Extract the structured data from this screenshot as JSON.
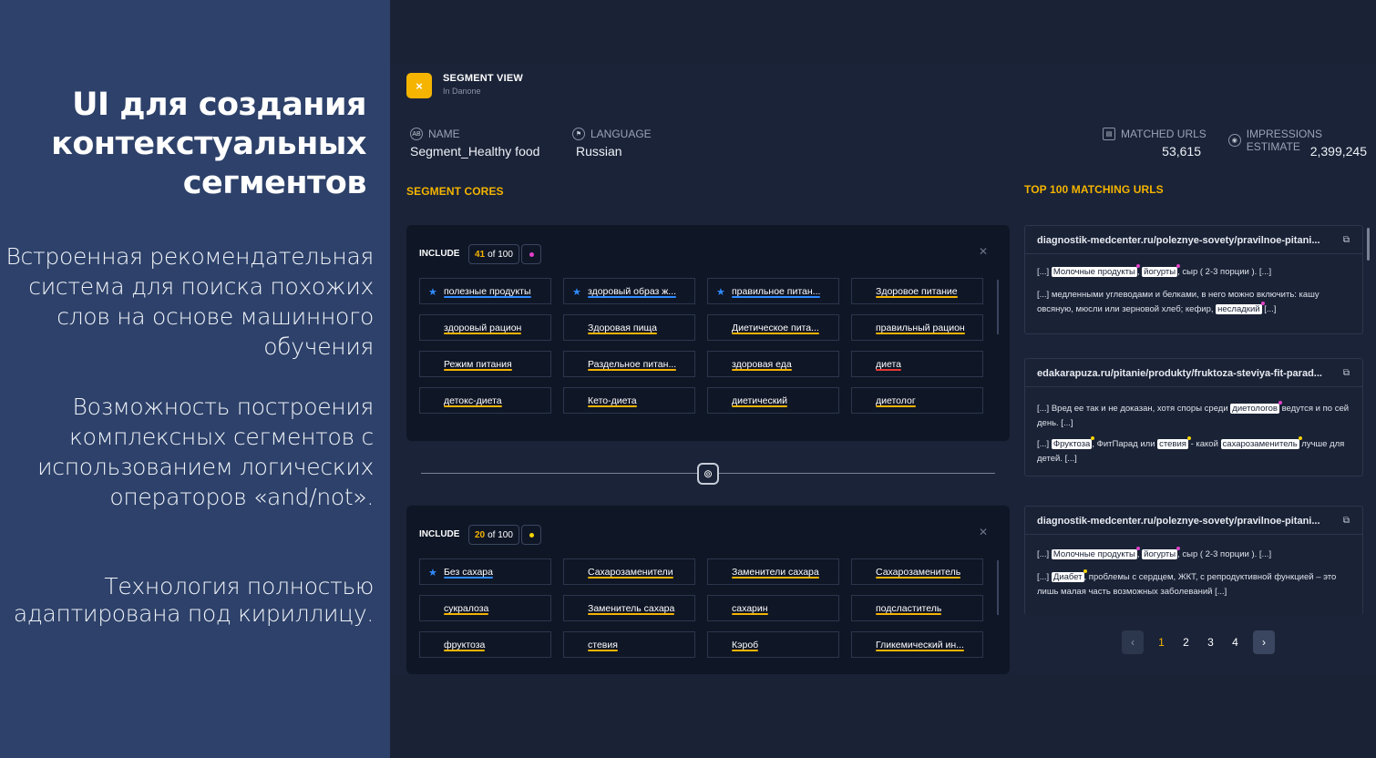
{
  "slide": {
    "title": "UI для создания контекстуальных сегментов",
    "p1": "Встроенная рекомендательная система для поиска похожих слов на основе машинного обучения",
    "p2": "Возможность построения комплексных сегментов с использованием логических операторов «and/not».",
    "p3": "Технология полностью адаптирована под кириллицу."
  },
  "header": {
    "logo": "×",
    "title": "SEGMENT VIEW",
    "subtitle": "In Danone"
  },
  "meta": {
    "name_label": "NAME",
    "name_icon": "AB",
    "name_value": "Segment_Healthy food",
    "language_label": "LANGUAGE",
    "language_icon": "flag-icon",
    "language_value": "Russian",
    "matched_label": "MATCHED URLS",
    "matched_icon": "document-icon",
    "matched_value": "53,615",
    "impressions_label": "IMPRESSIONS ESTIMATE",
    "impressions_icon": "eye-icon",
    "impressions_value": "2,399,245"
  },
  "segment_cores_title": "SEGMENT CORES",
  "top_urls_title": "TOP 100 MATCHING URLS",
  "cores": [
    {
      "include_label": "INCLUDE",
      "count_current": "41",
      "count_total": "of 100",
      "dot_color": "#e040c8",
      "chips": [
        {
          "label": "полезные продукты",
          "star": true,
          "color": "#2e8bff"
        },
        {
          "label": "здоровый образ ж...",
          "star": true,
          "color": "#2e8bff"
        },
        {
          "label": "правильное питан...",
          "star": true,
          "color": "#2e8bff"
        },
        {
          "label": "Здоровое питание",
          "star": false,
          "color": "#f5b400"
        },
        {
          "label": "здоровый рацион",
          "star": false,
          "color": "#f5b400"
        },
        {
          "label": "Здоровая пища",
          "star": false,
          "color": "#f5b400"
        },
        {
          "label": "Диетическое пита...",
          "star": false,
          "color": "#f5b400"
        },
        {
          "label": "правильный рацион",
          "star": false,
          "color": "#f5b400"
        },
        {
          "label": "Режим питания",
          "star": false,
          "color": "#f5b400"
        },
        {
          "label": "Раздельное питан...",
          "star": false,
          "color": "#f5b400"
        },
        {
          "label": "здоровая еда",
          "star": false,
          "color": "#f5b400"
        },
        {
          "label": "диета",
          "star": false,
          "color": "#e53935"
        },
        {
          "label": "детокс-диета",
          "star": false,
          "color": "#f5b400"
        },
        {
          "label": "Кето-диета",
          "star": false,
          "color": "#f5b400"
        },
        {
          "label": "диетический",
          "star": false,
          "color": "#f5b400"
        },
        {
          "label": "диетолог",
          "star": false,
          "color": "#f5b400"
        }
      ]
    },
    {
      "include_label": "INCLUDE",
      "count_current": "20",
      "count_total": "of 100",
      "dot_color": "#f5d400",
      "chips": [
        {
          "label": "Без сахара",
          "star": true,
          "color": "#2e8bff"
        },
        {
          "label": "Сахарозаменители",
          "star": false,
          "color": "#f5b400"
        },
        {
          "label": "Заменители сахара",
          "star": false,
          "color": "#f5b400"
        },
        {
          "label": "Сахарозаменитель",
          "star": false,
          "color": "#f5b400"
        },
        {
          "label": "сукралоза",
          "star": false,
          "color": "#f5b400"
        },
        {
          "label": "Заменитель сахара",
          "star": false,
          "color": "#f5b400"
        },
        {
          "label": "сахарин",
          "star": false,
          "color": "#f5b400"
        },
        {
          "label": "подсластитель",
          "star": false,
          "color": "#f5b400"
        },
        {
          "label": "фруктоза",
          "star": false,
          "color": "#f5b400"
        },
        {
          "label": "стевия",
          "star": false,
          "color": "#f5b400"
        },
        {
          "label": "Кэроб",
          "star": false,
          "color": "#f5b400"
        },
        {
          "label": "Гликемический ин...",
          "star": false,
          "color": "#f5b400"
        }
      ]
    }
  ],
  "url_cards": [
    {
      "url": "diagnostik-medcenter.ru/poleznye-sovety/pravilnoe-pitani...",
      "snippets": [
        [
          {
            "t": "[...] "
          },
          {
            "h": "Молочные продукты",
            "m": "#e040c8"
          },
          {
            "t": ", "
          },
          {
            "h": "йогурты",
            "m": "#e040c8"
          },
          {
            "t": ", сыр ( 2-3 порции ). [...]"
          }
        ],
        [
          {
            "t": "[...] медленными углеводами и белками, в него можно включить: кашу овсяную, мюсли или зерновой хлеб; кефир, "
          },
          {
            "h": "несладкий",
            "m": "#e040c8"
          },
          {
            "t": " [...]"
          }
        ]
      ]
    },
    {
      "url": "edakarapuza.ru/pitanie/produkty/fruktoza-steviya-fit-parad...",
      "snippets": [
        [
          {
            "t": "[...] Вред ее так и не доказан, хотя споры среди "
          },
          {
            "h": "диетологов",
            "m": "#e040c8"
          },
          {
            "t": " ведутся и по сей день. [...]"
          }
        ],
        [
          {
            "t": "[...] "
          },
          {
            "h": "Фруктоза",
            "m": "#f5d400"
          },
          {
            "t": ", ФитПарад или "
          },
          {
            "h": "стевия",
            "m": "#f5d400"
          },
          {
            "t": " - какой "
          },
          {
            "h": "сахарозаменитель",
            "m": "#f5d400"
          },
          {
            "t": " лучше для детей. [...]"
          }
        ]
      ]
    },
    {
      "url": "diagnostik-medcenter.ru/poleznye-sovety/pravilnoe-pitani...",
      "snippets": [
        [
          {
            "t": "[...] "
          },
          {
            "h": "Молочные продукты",
            "m": "#e040c8"
          },
          {
            "t": ", "
          },
          {
            "h": "йогурты",
            "m": "#e040c8"
          },
          {
            "t": ", сыр ( 2-3 порции ). [...]"
          }
        ],
        [
          {
            "t": "[...] "
          },
          {
            "h": "Диабет",
            "m": "#f5d400"
          },
          {
            "t": ", проблемы с сердцем, ЖКТ, с репродуктивной функцией – это лишь малая часть возможных заболеваний [...]"
          }
        ]
      ]
    }
  ],
  "pagination": {
    "prev": "‹",
    "pages": [
      "1",
      "2",
      "3",
      "4"
    ],
    "active": "1",
    "next": "›"
  }
}
